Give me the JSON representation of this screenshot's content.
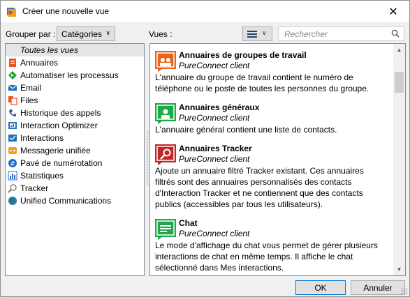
{
  "window": {
    "title": "Créer une nouvelle vue",
    "close_glyph": "✕"
  },
  "toolbar": {
    "group_by_label": "Grouper par :",
    "group_by_value": "Catégories",
    "views_label": "Vues :",
    "search_placeholder": "Rechercher"
  },
  "categories": {
    "all_label": "Toutes les vues",
    "items": [
      {
        "label": "Annuaires",
        "icon": "directory-icon",
        "color": "#e8541c"
      },
      {
        "label": "Automatiser les processus",
        "icon": "process-automation-icon",
        "color": "#1a9e3a"
      },
      {
        "label": "Email",
        "icon": "email-icon",
        "color": "#1a6fc2"
      },
      {
        "label": "Files",
        "icon": "queues-icon",
        "color": "#e8541c"
      },
      {
        "label": "Historique des appels",
        "icon": "call-history-icon",
        "color": "#2a5a9a"
      },
      {
        "label": "Interaction Optimizer",
        "icon": "optimizer-icon",
        "color": "#2a6fc2"
      },
      {
        "label": "Interactions",
        "icon": "interactions-icon",
        "color": "#1a6fc2"
      },
      {
        "label": "Messagerie unifiée",
        "icon": "voicemail-icon",
        "color": "#f0a020"
      },
      {
        "label": "Pavé de numérotation",
        "icon": "dialpad-icon",
        "color": "#1a6fc2"
      },
      {
        "label": "Statistiques",
        "icon": "statistics-icon",
        "color": "#2a6fc2"
      },
      {
        "label": "Tracker",
        "icon": "tracker-icon",
        "color": "#808080"
      },
      {
        "label": "Unified Communications",
        "icon": "unified-communications-icon",
        "color": "#1a8a3a"
      }
    ]
  },
  "views": [
    {
      "name": "Annuaires de groupes de travail",
      "source": "PureConnect client",
      "description": "L'annuaire du groupe de travail contient le numéro de téléphone ou le poste de toutes les personnes du groupe.",
      "icon": "workgroup-directory-icon",
      "color": "#e8641c"
    },
    {
      "name": "Annuaires généraux",
      "source": "PureConnect client",
      "description": "L'annuaire général contient une liste de contacts.",
      "icon": "general-directory-icon",
      "color": "#1ea84a"
    },
    {
      "name": "Annuaires Tracker",
      "source": "PureConnect client",
      "description": "Ajoute un annuaire filtré Tracker existant. Ces annuaires filtrés sont des annuaires personnalisés des contacts d'Interaction Tracker et ne contiennent que des contacts publics (accessibles par tous les utilisateurs).",
      "icon": "tracker-directory-icon",
      "color": "#c02828"
    },
    {
      "name": "Chat",
      "source": "PureConnect client",
      "description": "Le mode d'affichage du chat vous permet de gérer plusieurs interactions de chat en même temps. Il affiche le chat sélectionné dans Mes interactions.",
      "icon": "chat-icon",
      "color": "#1ea84a"
    }
  ],
  "buttons": {
    "ok": "OK",
    "cancel": "Annuler"
  }
}
